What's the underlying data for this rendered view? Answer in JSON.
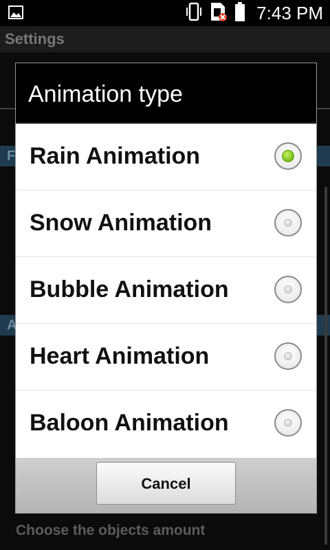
{
  "status_bar": {
    "time": "7:43 PM",
    "icons": [
      "image-icon",
      "vibrate-icon",
      "no-sim-icon",
      "battery-icon"
    ]
  },
  "background": {
    "screen_title": "Settings",
    "section1_initial": "F",
    "section2_initial": "A",
    "subtitle": "Choose the objects amount"
  },
  "dialog": {
    "title": "Animation type",
    "options": [
      {
        "label": "Rain Animation",
        "selected": true
      },
      {
        "label": "Snow Animation",
        "selected": false
      },
      {
        "label": "Bubble Animation",
        "selected": false
      },
      {
        "label": "Heart Animation",
        "selected": false
      },
      {
        "label": "Baloon Animation",
        "selected": false
      }
    ],
    "cancel_label": "Cancel"
  },
  "colors": {
    "accent_green": "#7fc51f",
    "header_blue": "#1f3b4f"
  }
}
